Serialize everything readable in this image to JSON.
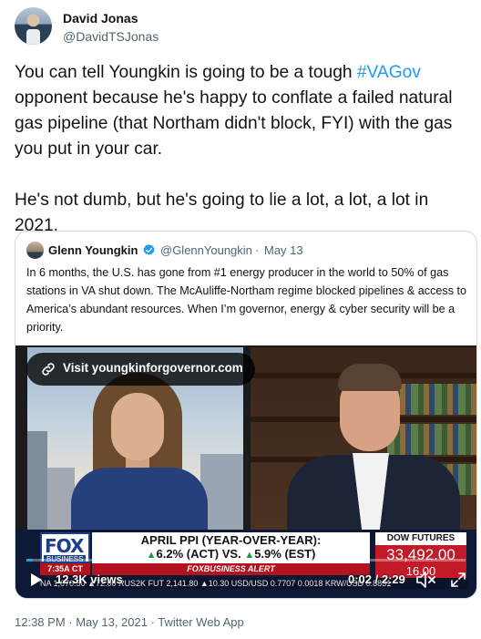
{
  "author": {
    "display_name": "David Jonas",
    "handle": "@DavidTSJonas"
  },
  "tweet": {
    "text_before_hashtag": "You can tell Youngkin is going to be a tough ",
    "hashtag": "#VAGov",
    "text_after_hashtag": "\nopponent because he's happy to conflate a failed natural gas pipeline (that Northam didn't block, FYI) with the gas you put in your car.\n\nHe's not dumb, but he's going to lie a lot, a lot, a lot in 2021."
  },
  "quoted_tweet": {
    "display_name": "Glenn Youngkin",
    "handle": "@GlennYoungkin",
    "separator": "·",
    "date": "May 13",
    "text": "In 6 months, the U.S. has gone from #1 energy producer in the world to 50% of gas stations in VA shut down. The McAuliffe-Northam regime blocked pipelines & access to America’s abundant resources. When I’m governor, energy & cyber security will be a priority."
  },
  "video": {
    "link_label": "Visit youngkinforgovernor.com",
    "views": "12.3K views",
    "timecode": "0:02 / 2:29",
    "progress_fraction": 0.014,
    "chyron": {
      "network": "FOX",
      "network_sub": "BUSINESS",
      "headline_line1": "APRIL PPI (YEAR-OVER-YEAR):",
      "headline_act": "6.2% (ACT) VS.",
      "headline_est": "5.9% (EST)",
      "time_badge": "7:35A CT",
      "alert": "FOXBUSINESS ALERT",
      "dow_label": "DOW FUTURES",
      "dow_value": "33,492.00",
      "dow_change": "16.00",
      "ticker": "NA   1,070.50  ▲72.00   RUS2K FUT   2,141.80  ▲10.30   USD/USD  0.7707   0.0018   KRW/USD  0.8831"
    }
  },
  "footer": {
    "timestamp": "12:38 PM · May 13, 2021 · Twitter Web App"
  },
  "colors": {
    "link_blue": "#1d9bf0",
    "secondary_text": "#536471",
    "border": "#cfd9de"
  }
}
